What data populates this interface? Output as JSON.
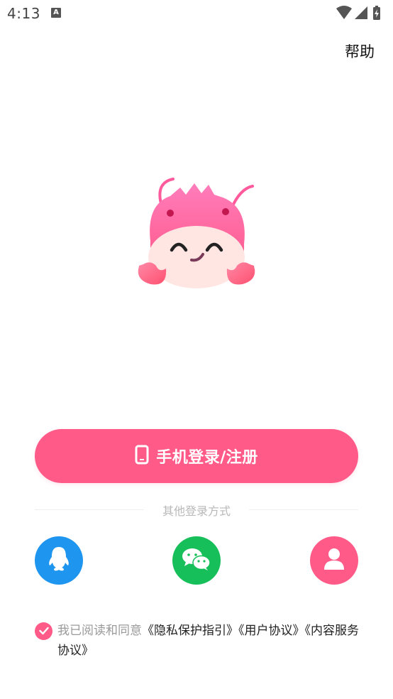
{
  "status_bar": {
    "time": "4:13",
    "notification_letter": "A",
    "icons": [
      "wifi-icon",
      "signal-icon",
      "battery-charging-icon"
    ]
  },
  "header": {
    "help_label": "帮助"
  },
  "mascot": {
    "icon": "lobster-mascot-logo",
    "colors": {
      "body": "#ff6fa6",
      "face": "#ffe8e6",
      "accent": "#ff5a88"
    }
  },
  "login": {
    "phone_login_label": "手机登录/注册",
    "phone_icon": "mobile-phone-icon"
  },
  "other_login": {
    "title": "其他登录方式",
    "options": [
      {
        "name": "qq",
        "icon": "qq-icon",
        "color": "#1e95ef"
      },
      {
        "name": "wechat",
        "icon": "wechat-icon",
        "color": "#17bf5a"
      },
      {
        "name": "guest",
        "icon": "user-icon",
        "color": "#ff5a88"
      }
    ]
  },
  "agreement": {
    "checked": true,
    "prefix": "我已阅读和同意",
    "links": [
      "《隐私保护指引》",
      "《用户协议》",
      "《内容服务协议》"
    ]
  },
  "theme": {
    "primary": "#ff5a88",
    "divider_text": "#b8b8b8"
  }
}
